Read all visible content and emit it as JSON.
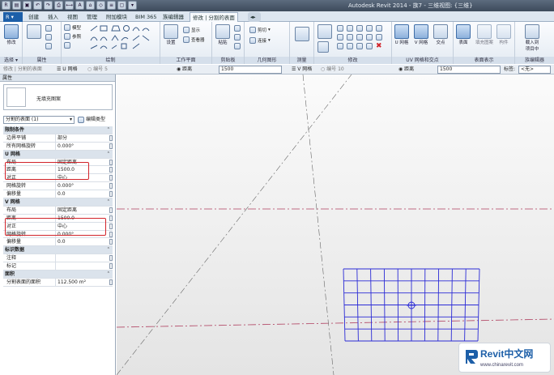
{
  "window": {
    "app_title": "Autodesk Revit 2014 -",
    "doc_title": "族7 - 三维视图: {三维}",
    "min_label": "–",
    "max_label": "□",
    "close_label": "✕"
  },
  "tabs": [
    "创建",
    "插入",
    "视图",
    "管理",
    "附加模块",
    "BIM 365",
    "族编辑器",
    "修改 | 分割的表面"
  ],
  "ribbon": {
    "panels": {
      "select": "选择 ▾",
      "properties": "属性",
      "draw": "绘制",
      "workplane": "工作平面",
      "clipboard": "剪贴板",
      "geometry": "几何图形",
      "measure": "测量",
      "modify": "修改",
      "uv_grid": "UV 网格和交点",
      "surface_repr": "表面表示",
      "family_editor": "族编辑器"
    },
    "buttons": {
      "modify": "修改",
      "model": "模型",
      "ref": "参照",
      "set": "设置",
      "show": "显示",
      "viewer": "查看器",
      "paste": "粘贴",
      "cut": "剪切",
      "join": "连接",
      "u_grid": "U 网格",
      "v_grid": "V 网格",
      "intersect": "交点",
      "surface": "表面",
      "fill_pattern": "填充图案",
      "component": "构件",
      "load_into_project": "载入到\n项目中"
    }
  },
  "options_bar": {
    "mode": "修改 | 分割的表面",
    "u_grid_label": "U 网格",
    "number_label": "编号",
    "number_value": "5",
    "distance_label": "距离",
    "distance_value": "1500",
    "v_grid_label": "V 网格",
    "v_number_label": "编号",
    "v_number_value": "10",
    "v_distance_label": "距离",
    "v_distance_value": "1500",
    "tag_label": "标签:",
    "tag_value": "<无>"
  },
  "properties": {
    "title": "属性",
    "type_name": "无填充图案",
    "selector": "分割的表面 (1)",
    "edit_type": "编辑类型",
    "rows": [
      {
        "kind": "group",
        "k": "限制条件"
      },
      {
        "kind": "row",
        "k": "边界平铺",
        "v": "部分"
      },
      {
        "kind": "row",
        "k": "所有网格旋转",
        "v": "0.000°"
      },
      {
        "kind": "group",
        "k": "U 网格"
      },
      {
        "kind": "row",
        "k": "布局",
        "v": "固定距离"
      },
      {
        "kind": "row",
        "k": "距离",
        "v": "1500.0"
      },
      {
        "kind": "row",
        "k": "对正",
        "v": "中心"
      },
      {
        "kind": "row",
        "k": "网格旋转",
        "v": "0.000°"
      },
      {
        "kind": "row",
        "k": "偏移量",
        "v": "0.0"
      },
      {
        "kind": "group",
        "k": "V 网格"
      },
      {
        "kind": "row",
        "k": "布局",
        "v": "固定距离"
      },
      {
        "kind": "row",
        "k": "距离",
        "v": "1500.0"
      },
      {
        "kind": "row",
        "k": "对正",
        "v": "中心"
      },
      {
        "kind": "row",
        "k": "网格旋转",
        "v": "0.000°"
      },
      {
        "kind": "row",
        "k": "偏移量",
        "v": "0.0"
      },
      {
        "kind": "group",
        "k": "标识数据"
      },
      {
        "kind": "row",
        "k": "注释",
        "v": ""
      },
      {
        "kind": "row",
        "k": "标记",
        "v": ""
      },
      {
        "kind": "group",
        "k": "面积"
      },
      {
        "kind": "row",
        "k": "分割表面的面积",
        "v": "112.500 m²"
      }
    ]
  },
  "watermark": {
    "brand": "Revit中文网",
    "url": "www.chinarevit.com"
  },
  "colors": {
    "grid": "#2b2bd6",
    "highlight": "#d2232a",
    "ref_line": "#b04060"
  }
}
